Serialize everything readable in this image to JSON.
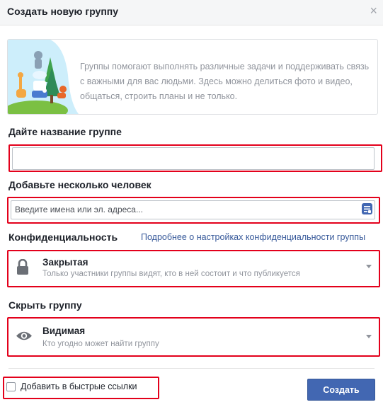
{
  "dialog": {
    "title": "Создать новую группу",
    "close_glyph": "×"
  },
  "intro": {
    "text": "Группы помогают выполнять различные задачи и поддерживать связь с важными для вас людьми. Здесь можно делиться фото и видео, общаться, строить планы и не только."
  },
  "name_section": {
    "label": "Дайте название группе",
    "value": ""
  },
  "people_section": {
    "label": "Добавьте несколько человек",
    "placeholder": "Введите имена или эл. адреса...",
    "icon": "contacts-icon"
  },
  "privacy": {
    "label": "Конфиденциальность",
    "link": "Подробнее о настройках конфиденциальности группы",
    "selected_title": "Закрытая",
    "selected_desc": "Только участники группы видят, кто в ней состоит и что публикуется",
    "icon": "lock-icon"
  },
  "visibility": {
    "label": "Скрыть группу",
    "selected_title": "Видимая",
    "selected_desc": "Кто угодно может найти группу",
    "icon": "eye-icon"
  },
  "footer": {
    "quick_links_label": "Добавить в быстрые ссылки",
    "quick_links_checked": false,
    "create_button": "Создать"
  },
  "colors": {
    "accent": "#4267b2",
    "link": "#365899",
    "highlight": "#e3001b",
    "muted_text": "#90949c"
  }
}
